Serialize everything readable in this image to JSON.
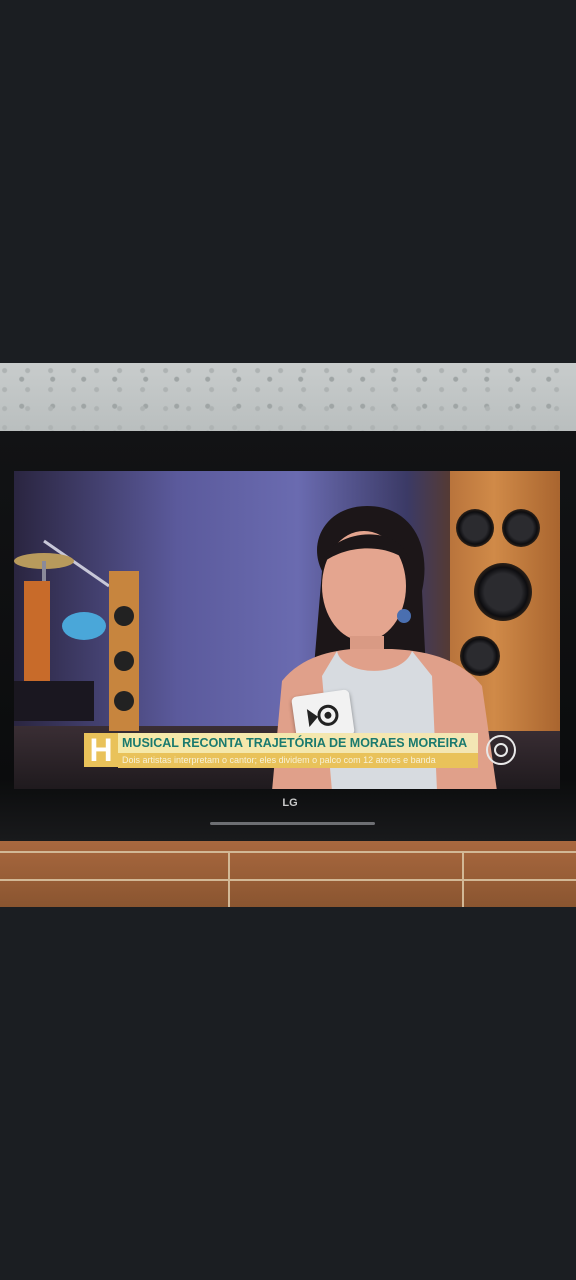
{
  "broadcast": {
    "badge": "H",
    "headline": "MUSICAL RECONTA TRAJETÓRIA DE MORAES MOREIRA",
    "subline": "Dois artistas interpretam o cantor; eles dividem o palco com 12 atores e banda",
    "channel_logo": "globo-logo"
  },
  "tv": {
    "brand": "LG"
  },
  "colors": {
    "background": "#1b1e22",
    "banner_yellow": "#e9c25a",
    "headline_text": "#1a7a6e"
  }
}
